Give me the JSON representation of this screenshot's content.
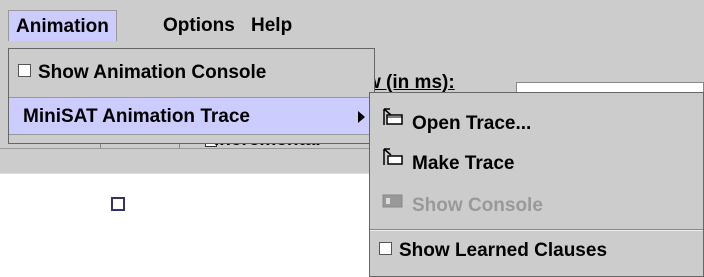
{
  "menubar": {
    "items": [
      {
        "label": "Animation"
      },
      {
        "label": "Options"
      },
      {
        "label": "Help"
      }
    ]
  },
  "background": {
    "label": "w (in ms):",
    "partial_label": "Incremental"
  },
  "dropdown": {
    "items": [
      {
        "label": "Show Animation Console",
        "checked": false
      },
      {
        "label": "MiniSAT Animation Trace"
      }
    ]
  },
  "submenu": {
    "items": [
      {
        "label": "Open Trace...",
        "icon": "open-trace-icon",
        "enabled": true
      },
      {
        "label": "Make Trace",
        "icon": "make-trace-icon",
        "enabled": true
      },
      {
        "label": "Show Console",
        "icon": "console-icon",
        "enabled": false
      },
      {
        "label": "Show Learned Clauses",
        "checked": false
      }
    ]
  },
  "colors": {
    "menu_bg": "#cccccc",
    "highlight": "#ccccff",
    "disabled_text": "#999999"
  }
}
